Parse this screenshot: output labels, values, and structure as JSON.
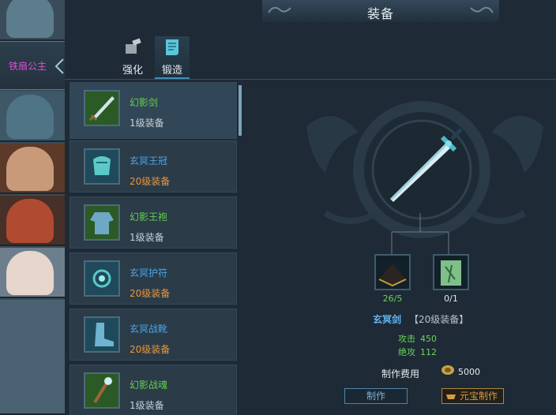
{
  "window": {
    "title": "装备"
  },
  "heroes": {
    "selected": "铁扇公主"
  },
  "tabs": [
    {
      "id": "enhance",
      "label": "强化",
      "icon": "anvil-icon",
      "active": false
    },
    {
      "id": "forge",
      "label": "锻造",
      "icon": "scroll-icon",
      "active": true
    }
  ],
  "items": [
    {
      "name": "幻影剑",
      "level": "1级装备",
      "name_color": "#62d04c",
      "level_color": "#c9d2d8",
      "icon": "sword-icon"
    },
    {
      "name": "玄冥王冠",
      "level": "20级装备",
      "name_color": "#4aa6e6",
      "level_color": "#e8973a",
      "icon": "crown-icon"
    },
    {
      "name": "幻影王袍",
      "level": "1级装备",
      "name_color": "#62d04c",
      "level_color": "#c9d2d8",
      "icon": "robe-icon"
    },
    {
      "name": "玄冥护符",
      "level": "20级装备",
      "name_color": "#4aa6e6",
      "level_color": "#e8973a",
      "icon": "amulet-icon"
    },
    {
      "name": "玄冥战靴",
      "level": "20级装备",
      "name_color": "#4aa6e6",
      "level_color": "#e8973a",
      "icon": "boots-icon"
    },
    {
      "name": "幻影战魂",
      "level": "1级装备",
      "name_color": "#62d04c",
      "level_color": "#c9d2d8",
      "icon": "staff-icon"
    }
  ],
  "craft": {
    "result_name": "玄冥剑",
    "result_level": "【20级装备】",
    "materials": [
      {
        "icon": "ore-pile-icon",
        "count": "26/5",
        "count_color": "#6ad45a"
      },
      {
        "icon": "recipe-scroll-icon",
        "count": "0/1",
        "count_color": "#e4eaee"
      }
    ],
    "stats": [
      {
        "label": "攻击",
        "value": "450"
      },
      {
        "label": "绝攻",
        "value": "112"
      }
    ],
    "cost_label": "制作费用",
    "cost_value": "5000",
    "make_button": "制作",
    "gold_make_button": "元宝制作"
  }
}
